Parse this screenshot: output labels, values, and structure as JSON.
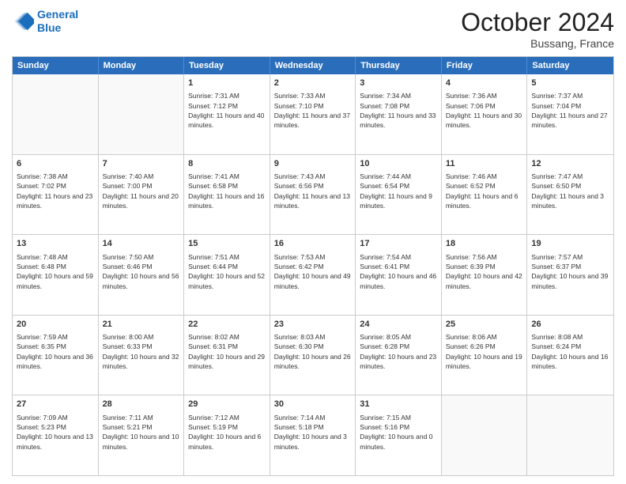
{
  "header": {
    "logo_line1": "General",
    "logo_line2": "Blue",
    "month": "October 2024",
    "location": "Bussang, France"
  },
  "weekdays": [
    "Sunday",
    "Monday",
    "Tuesday",
    "Wednesday",
    "Thursday",
    "Friday",
    "Saturday"
  ],
  "rows": [
    [
      {
        "day": "",
        "sunrise": "",
        "sunset": "",
        "daylight": ""
      },
      {
        "day": "",
        "sunrise": "",
        "sunset": "",
        "daylight": ""
      },
      {
        "day": "1",
        "sunrise": "Sunrise: 7:31 AM",
        "sunset": "Sunset: 7:12 PM",
        "daylight": "Daylight: 11 hours and 40 minutes."
      },
      {
        "day": "2",
        "sunrise": "Sunrise: 7:33 AM",
        "sunset": "Sunset: 7:10 PM",
        "daylight": "Daylight: 11 hours and 37 minutes."
      },
      {
        "day": "3",
        "sunrise": "Sunrise: 7:34 AM",
        "sunset": "Sunset: 7:08 PM",
        "daylight": "Daylight: 11 hours and 33 minutes."
      },
      {
        "day": "4",
        "sunrise": "Sunrise: 7:36 AM",
        "sunset": "Sunset: 7:06 PM",
        "daylight": "Daylight: 11 hours and 30 minutes."
      },
      {
        "day": "5",
        "sunrise": "Sunrise: 7:37 AM",
        "sunset": "Sunset: 7:04 PM",
        "daylight": "Daylight: 11 hours and 27 minutes."
      }
    ],
    [
      {
        "day": "6",
        "sunrise": "Sunrise: 7:38 AM",
        "sunset": "Sunset: 7:02 PM",
        "daylight": "Daylight: 11 hours and 23 minutes."
      },
      {
        "day": "7",
        "sunrise": "Sunrise: 7:40 AM",
        "sunset": "Sunset: 7:00 PM",
        "daylight": "Daylight: 11 hours and 20 minutes."
      },
      {
        "day": "8",
        "sunrise": "Sunrise: 7:41 AM",
        "sunset": "Sunset: 6:58 PM",
        "daylight": "Daylight: 11 hours and 16 minutes."
      },
      {
        "day": "9",
        "sunrise": "Sunrise: 7:43 AM",
        "sunset": "Sunset: 6:56 PM",
        "daylight": "Daylight: 11 hours and 13 minutes."
      },
      {
        "day": "10",
        "sunrise": "Sunrise: 7:44 AM",
        "sunset": "Sunset: 6:54 PM",
        "daylight": "Daylight: 11 hours and 9 minutes."
      },
      {
        "day": "11",
        "sunrise": "Sunrise: 7:46 AM",
        "sunset": "Sunset: 6:52 PM",
        "daylight": "Daylight: 11 hours and 6 minutes."
      },
      {
        "day": "12",
        "sunrise": "Sunrise: 7:47 AM",
        "sunset": "Sunset: 6:50 PM",
        "daylight": "Daylight: 11 hours and 3 minutes."
      }
    ],
    [
      {
        "day": "13",
        "sunrise": "Sunrise: 7:48 AM",
        "sunset": "Sunset: 6:48 PM",
        "daylight": "Daylight: 10 hours and 59 minutes."
      },
      {
        "day": "14",
        "sunrise": "Sunrise: 7:50 AM",
        "sunset": "Sunset: 6:46 PM",
        "daylight": "Daylight: 10 hours and 56 minutes."
      },
      {
        "day": "15",
        "sunrise": "Sunrise: 7:51 AM",
        "sunset": "Sunset: 6:44 PM",
        "daylight": "Daylight: 10 hours and 52 minutes."
      },
      {
        "day": "16",
        "sunrise": "Sunrise: 7:53 AM",
        "sunset": "Sunset: 6:42 PM",
        "daylight": "Daylight: 10 hours and 49 minutes."
      },
      {
        "day": "17",
        "sunrise": "Sunrise: 7:54 AM",
        "sunset": "Sunset: 6:41 PM",
        "daylight": "Daylight: 10 hours and 46 minutes."
      },
      {
        "day": "18",
        "sunrise": "Sunrise: 7:56 AM",
        "sunset": "Sunset: 6:39 PM",
        "daylight": "Daylight: 10 hours and 42 minutes."
      },
      {
        "day": "19",
        "sunrise": "Sunrise: 7:57 AM",
        "sunset": "Sunset: 6:37 PM",
        "daylight": "Daylight: 10 hours and 39 minutes."
      }
    ],
    [
      {
        "day": "20",
        "sunrise": "Sunrise: 7:59 AM",
        "sunset": "Sunset: 6:35 PM",
        "daylight": "Daylight: 10 hours and 36 minutes."
      },
      {
        "day": "21",
        "sunrise": "Sunrise: 8:00 AM",
        "sunset": "Sunset: 6:33 PM",
        "daylight": "Daylight: 10 hours and 32 minutes."
      },
      {
        "day": "22",
        "sunrise": "Sunrise: 8:02 AM",
        "sunset": "Sunset: 6:31 PM",
        "daylight": "Daylight: 10 hours and 29 minutes."
      },
      {
        "day": "23",
        "sunrise": "Sunrise: 8:03 AM",
        "sunset": "Sunset: 6:30 PM",
        "daylight": "Daylight: 10 hours and 26 minutes."
      },
      {
        "day": "24",
        "sunrise": "Sunrise: 8:05 AM",
        "sunset": "Sunset: 6:28 PM",
        "daylight": "Daylight: 10 hours and 23 minutes."
      },
      {
        "day": "25",
        "sunrise": "Sunrise: 8:06 AM",
        "sunset": "Sunset: 6:26 PM",
        "daylight": "Daylight: 10 hours and 19 minutes."
      },
      {
        "day": "26",
        "sunrise": "Sunrise: 8:08 AM",
        "sunset": "Sunset: 6:24 PM",
        "daylight": "Daylight: 10 hours and 16 minutes."
      }
    ],
    [
      {
        "day": "27",
        "sunrise": "Sunrise: 7:09 AM",
        "sunset": "Sunset: 5:23 PM",
        "daylight": "Daylight: 10 hours and 13 minutes."
      },
      {
        "day": "28",
        "sunrise": "Sunrise: 7:11 AM",
        "sunset": "Sunset: 5:21 PM",
        "daylight": "Daylight: 10 hours and 10 minutes."
      },
      {
        "day": "29",
        "sunrise": "Sunrise: 7:12 AM",
        "sunset": "Sunset: 5:19 PM",
        "daylight": "Daylight: 10 hours and 6 minutes."
      },
      {
        "day": "30",
        "sunrise": "Sunrise: 7:14 AM",
        "sunset": "Sunset: 5:18 PM",
        "daylight": "Daylight: 10 hours and 3 minutes."
      },
      {
        "day": "31",
        "sunrise": "Sunrise: 7:15 AM",
        "sunset": "Sunset: 5:16 PM",
        "daylight": "Daylight: 10 hours and 0 minutes."
      },
      {
        "day": "",
        "sunrise": "",
        "sunset": "",
        "daylight": ""
      },
      {
        "day": "",
        "sunrise": "",
        "sunset": "",
        "daylight": ""
      }
    ]
  ]
}
